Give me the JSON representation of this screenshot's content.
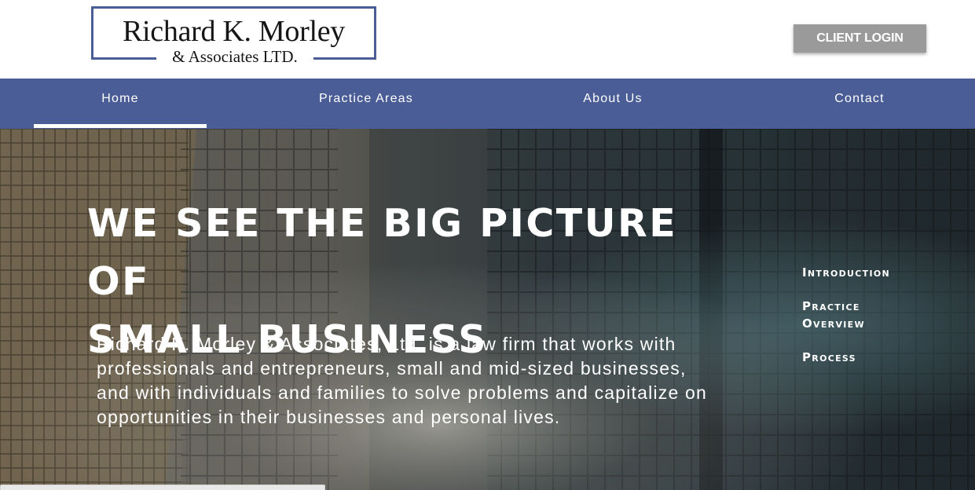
{
  "header": {
    "logo_main": "Richard K. Morley",
    "logo_sub": "& Associates LTD.",
    "client_login": "CLIENT LOGIN"
  },
  "nav": {
    "items": [
      {
        "label": "Home"
      },
      {
        "label": "Practice Areas"
      },
      {
        "label": "About Us"
      },
      {
        "label": "Contact"
      }
    ],
    "active": "Home"
  },
  "hero": {
    "headline_line1": "WE SEE THE BIG PICTURE OF",
    "headline_line2": "SMALL BUSINESS",
    "intro": "Richard K. Morley & Associates, Ltd. is a law firm that works with professionals and entrepreneurs, small and mid-sized businesses, and with individuals and families to solve problems and capitalize on opportunities in their businesses and personal lives."
  },
  "side_nav": {
    "items": [
      {
        "label": "Introduction"
      },
      {
        "label": "Practice Overview"
      },
      {
        "label": "Process"
      }
    ]
  },
  "colors": {
    "brand_blue": "#4a5d96",
    "login_button": "#9a9a9a",
    "text_on_dark": "#ffffff"
  }
}
